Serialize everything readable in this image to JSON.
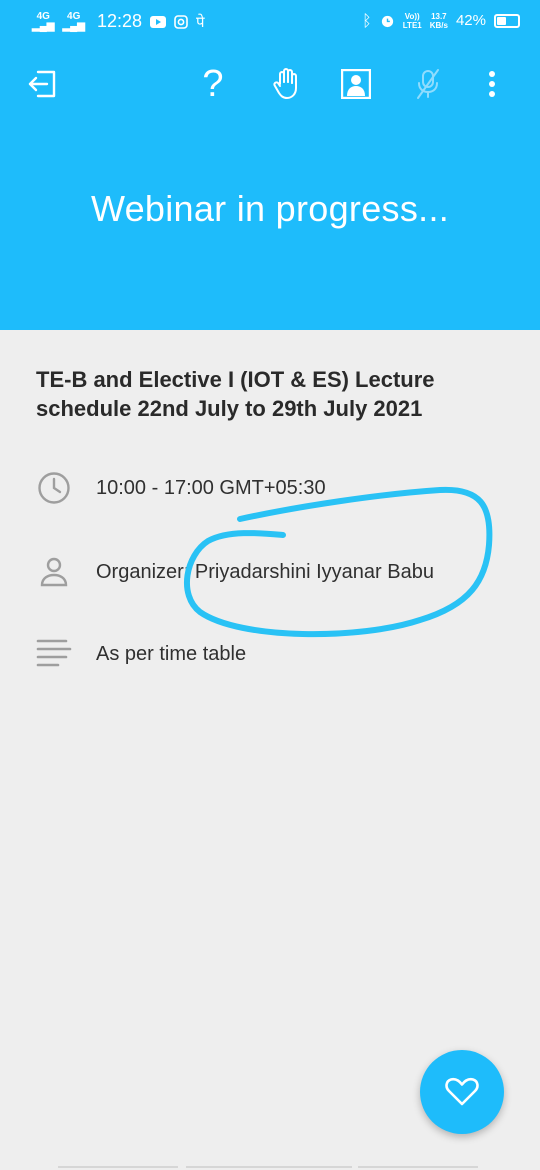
{
  "status_bar": {
    "net1": "4G",
    "net2": "4G",
    "time": "12:28",
    "volte_line1": "Vo))",
    "volte_line2": "LTE1",
    "speed_line1": "13.7",
    "speed_line2": "KB/s",
    "battery": "42%",
    "battery_level": 0.42
  },
  "header": {
    "title": "Webinar in progress...",
    "background_color": "#1ebcfb"
  },
  "toolbar": {
    "icons": [
      "exit-icon",
      "help-icon",
      "raise-hand-icon",
      "profile-icon",
      "mic-off-icon",
      "more-icon"
    ]
  },
  "meeting": {
    "title": "TE-B and Elective I (IOT & ES) Lecture schedule 22nd July to 29th July 2021",
    "time_text": "10:00 - 17:00 GMT+05:30",
    "organizer_text": "Organizer: Priyadarshini Iyyanar Babu",
    "description_text": "As per time table"
  },
  "annotation_color": "#29c2f5"
}
